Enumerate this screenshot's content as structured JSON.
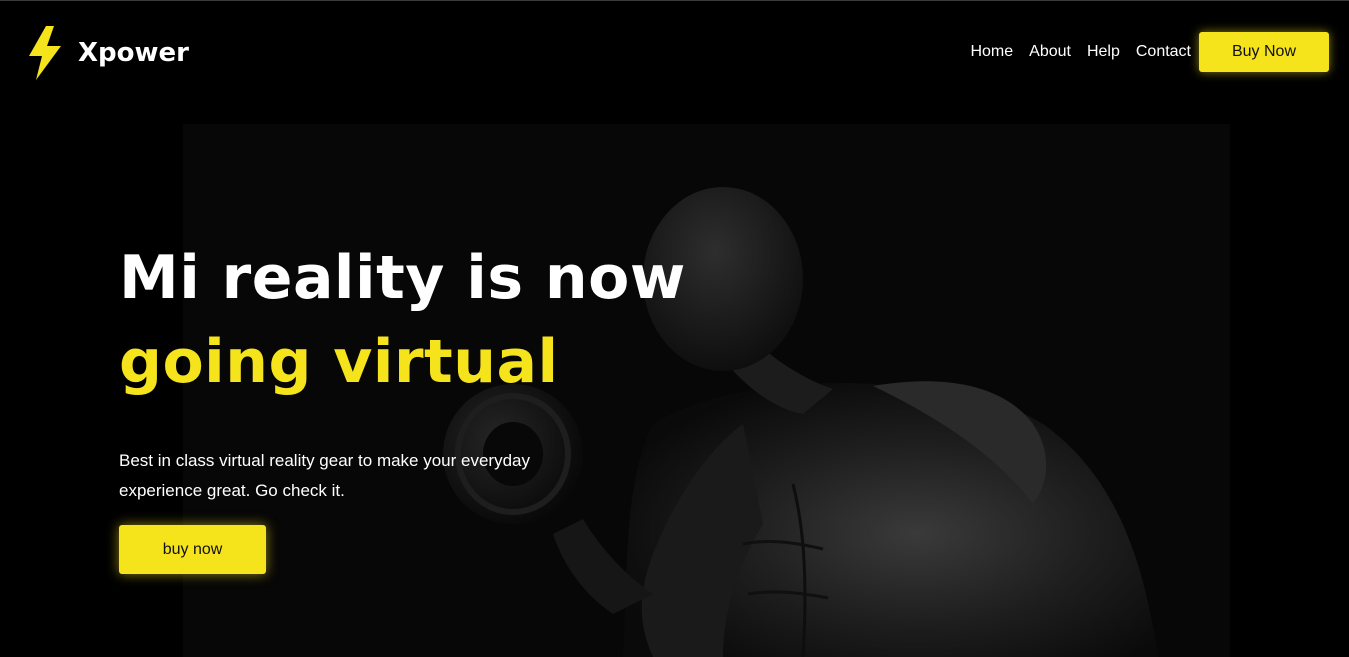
{
  "brand": {
    "name": "Xpower",
    "icon": "lightning-bolt-icon",
    "accent_color": "#f5e31c"
  },
  "nav": {
    "links": [
      "Home",
      "About",
      "Help",
      "Contact"
    ],
    "cta_label": "Buy Now"
  },
  "hero": {
    "title_line1": "Mi reality is now",
    "title_line2": "going virtual",
    "description": "Best in class virtual reality gear to make your everyday experience great. Go check it.",
    "cta_label": "buy now",
    "image": "dark-photo-of-man-lifting-dumbbell"
  },
  "colors": {
    "background": "#000000",
    "text": "#ffffff",
    "accent": "#f5e31c"
  }
}
